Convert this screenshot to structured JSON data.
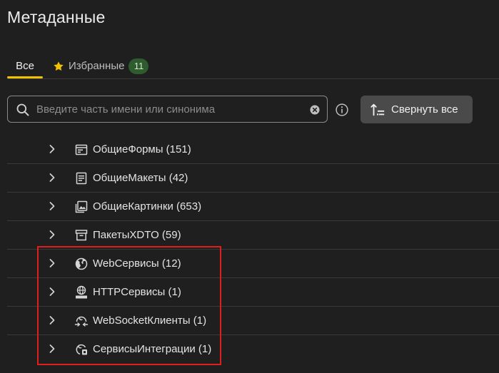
{
  "header": {
    "title": "Метаданные"
  },
  "tabs": [
    {
      "label": "Все",
      "active": true
    },
    {
      "label": "Избранные",
      "count": "11",
      "icon": "star-icon"
    }
  ],
  "search": {
    "placeholder": "Введите часть имени или синонима",
    "value": ""
  },
  "toolbar": {
    "collapse_label": "Свернуть все"
  },
  "tree": {
    "items": [
      {
        "label": "ОбщиеФормы (151)",
        "icon": "form-icon"
      },
      {
        "label": "ОбщиеМакеты (42)",
        "icon": "template-icon"
      },
      {
        "label": "ОбщиеКартинки (653)",
        "icon": "picture-icon"
      },
      {
        "label": "ПакетыXDTO (59)",
        "icon": "package-icon"
      },
      {
        "label": "WebСервисы (12)",
        "icon": "globe-icon"
      },
      {
        "label": "HTTPСервисы (1)",
        "icon": "http-globe-icon"
      },
      {
        "label": "WebSocketКлиенты (1)",
        "icon": "websocket-icon"
      },
      {
        "label": "СервисыИнтеграции (1)",
        "icon": "integration-icon"
      }
    ]
  },
  "colors": {
    "background": "#1f1f1f",
    "accent": "#f2c200",
    "badge": "#2f5c2e",
    "highlight": "#e01e1e"
  }
}
